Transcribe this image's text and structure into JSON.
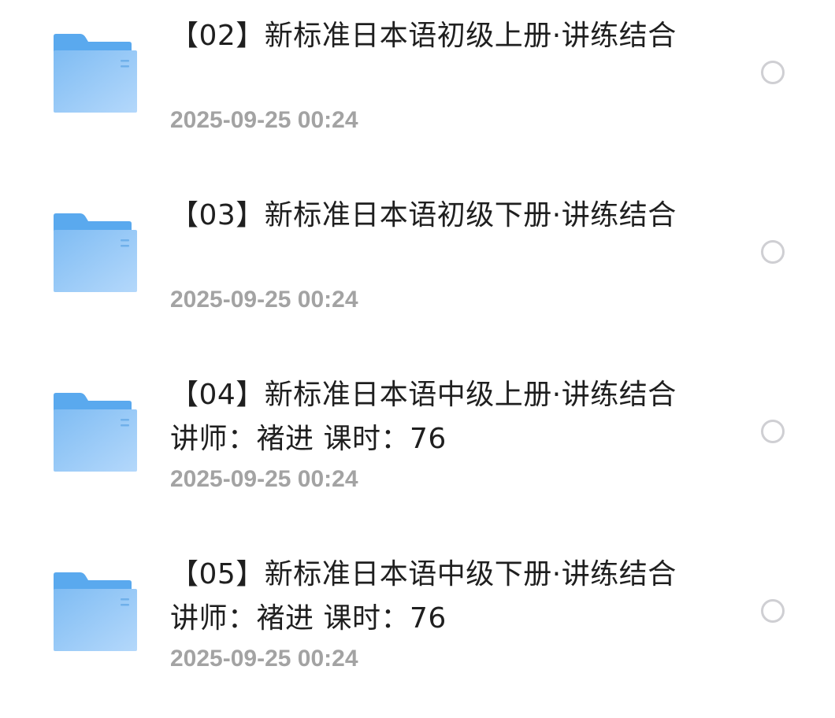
{
  "files": [
    {
      "name": "【02】新标准日本语初级上册·讲练结合",
      "date": "2025-09-25 00:24",
      "icon": "folder-icon",
      "selected": false
    },
    {
      "name": "【03】新标准日本语初级下册·讲练结合",
      "date": "2025-09-25 00:24",
      "icon": "folder-icon",
      "selected": false
    },
    {
      "name": "【04】新标准日本语中级上册·讲练结合 讲师：褚进 课时：76",
      "date": "2025-09-25 00:24",
      "icon": "folder-icon",
      "selected": false
    },
    {
      "name": "【05】新标准日本语中级下册·讲练结合 讲师：褚进 课时：76",
      "date": "2025-09-25 00:24",
      "icon": "folder-icon",
      "selected": false
    }
  ],
  "colors": {
    "folder_back": "#5aa9ee",
    "folder_front_top": "#7fbcf3",
    "folder_front_bottom": "#b4d8fb",
    "title_text": "#1f1f1f",
    "date_text": "#a3a3a3",
    "radio_border": "#cfcfd3"
  }
}
